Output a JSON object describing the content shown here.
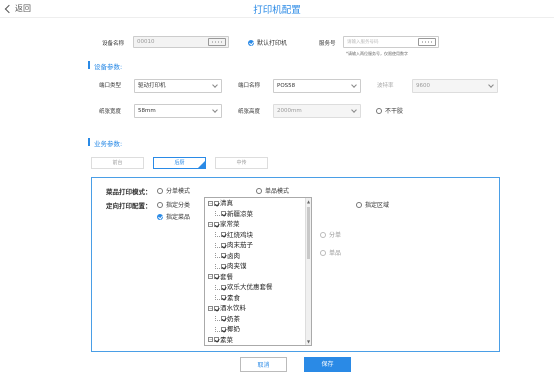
{
  "header": {
    "back_label": "返回",
    "title": "打印机配置"
  },
  "device": {
    "name_label": "设备名称",
    "name_value": "00010",
    "default_printer_label": "默认打印机",
    "server_label": "服务号",
    "server_placeholder": "请输入服务号码",
    "server_hint": "*请输入两位服务号，仅限使用数字"
  },
  "device_params": {
    "section_title": "设备参数:",
    "port_type_label": "端口类型",
    "port_type_value": "驱动打印机",
    "port_name_label": "端口名称",
    "port_name_value": "POS58",
    "baud_label": "波特率",
    "baud_value": "9600",
    "paper_width_label": "纸张宽度",
    "paper_width_value": "58mm",
    "paper_height_label": "纸张高度",
    "paper_height_value": "2000mm",
    "no_cut_label": "不干胶"
  },
  "business_params": {
    "section_title": "业务参数:",
    "tabs": [
      "前台",
      "后厨",
      "中传"
    ],
    "active_tab_index": 1,
    "print_mode_label": "菜品打印模式：",
    "mode_split": "分单模式",
    "mode_single": "单品模式",
    "mode_area": "指定区域",
    "directed_label": "定向打印配置：",
    "opt_category": "指定分类",
    "opt_dish": "指定菜品",
    "opt_split": "分单",
    "opt_single": "单品"
  },
  "tree": {
    "nodes": [
      {
        "text": "清真",
        "level": 0,
        "type": "folder"
      },
      {
        "text": "新疆凉菜",
        "level": 1,
        "type": "leaf"
      },
      {
        "text": "家常菜",
        "level": 0,
        "type": "folder"
      },
      {
        "text": "红烧鸡块",
        "level": 1,
        "type": "leaf"
      },
      {
        "text": "肉末茄子",
        "level": 1,
        "type": "leaf"
      },
      {
        "text": "卤肉",
        "level": 1,
        "type": "leaf"
      },
      {
        "text": "肉夹馍",
        "level": 1,
        "type": "leaf"
      },
      {
        "text": "套餐",
        "level": 0,
        "type": "folder"
      },
      {
        "text": "欢乐大优惠套餐",
        "level": 1,
        "type": "leaf"
      },
      {
        "text": "素食",
        "level": 1,
        "type": "leaf"
      },
      {
        "text": "酒水饮料",
        "level": 0,
        "type": "folder"
      },
      {
        "text": "奶茶",
        "level": 1,
        "type": "leaf"
      },
      {
        "text": "椰奶",
        "level": 1,
        "type": "leaf"
      },
      {
        "text": "素菜",
        "level": 0,
        "type": "folder"
      }
    ]
  },
  "footer": {
    "cancel_label": "取消",
    "save_label": "保存"
  },
  "colors": {
    "accent": "#2a8ae6"
  }
}
